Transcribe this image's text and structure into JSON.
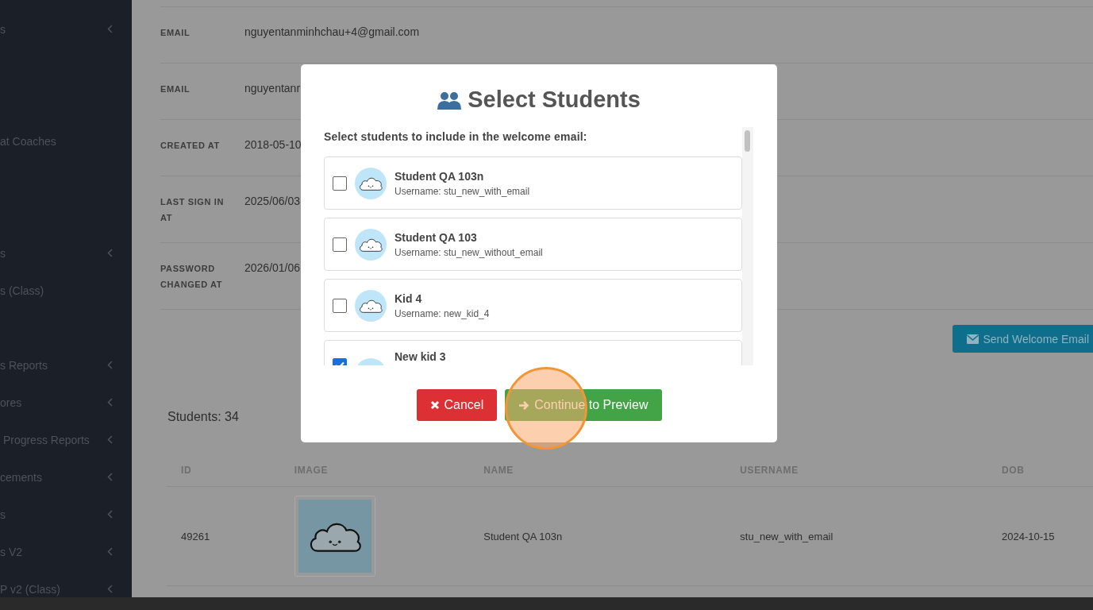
{
  "sidebar": {
    "items": [
      {
        "label": "s",
        "expandable": true
      },
      {
        "label": "at Coaches",
        "expandable": false
      },
      {
        "label": "s",
        "expandable": true
      },
      {
        "label": "s (Class)",
        "expandable": false
      },
      {
        "label": "s Reports",
        "expandable": true
      },
      {
        "label": "ores",
        "expandable": true
      },
      {
        "label": " Progress Reports",
        "expandable": true
      },
      {
        "label": "cements",
        "expandable": true
      },
      {
        "label": "s",
        "expandable": true
      },
      {
        "label": "s V2",
        "expandable": true
      },
      {
        "label": "P v2 (Class)",
        "expandable": true
      }
    ]
  },
  "details": [
    {
      "label": "EMAIL",
      "value": "nguyentanminhchau+4@gmail.com"
    },
    {
      "label": "EMAIL",
      "value": "nguyentanr"
    },
    {
      "label": "CREATED AT",
      "value": "2018-05-10"
    },
    {
      "label": "LAST SIGN IN AT",
      "value": "2025/06/03"
    },
    {
      "label": "PASSWORD CHANGED AT",
      "value": "2026/01/06"
    }
  ],
  "send_button": "Send Welcome Email",
  "students_count": "Students: 34",
  "table": {
    "columns": [
      "ID",
      "IMAGE",
      "NAME",
      "USERNAME",
      "DOB"
    ],
    "rows": [
      {
        "id": "49261",
        "name": "Student QA 103n",
        "username": "stu_new_with_email",
        "dob": "2024-10-15"
      }
    ]
  },
  "modal": {
    "title": "Select Students",
    "intro": "Select students to include in the welcome email:",
    "students": [
      {
        "name": "Student QA 103n",
        "username": "Username: stu_new_with_email",
        "checked": false
      },
      {
        "name": "Student QA 103",
        "username": "Username: stu_new_without_email",
        "checked": false
      },
      {
        "name": "Kid 4",
        "username": "Username: new_kid_4",
        "checked": false
      },
      {
        "name": "New kid 3",
        "checked": true
      }
    ],
    "buttons": [
      {
        "kind": "cancel",
        "label": "Cancel"
      },
      {
        "kind": "continue",
        "label": "Continue to Preview"
      }
    ]
  }
}
